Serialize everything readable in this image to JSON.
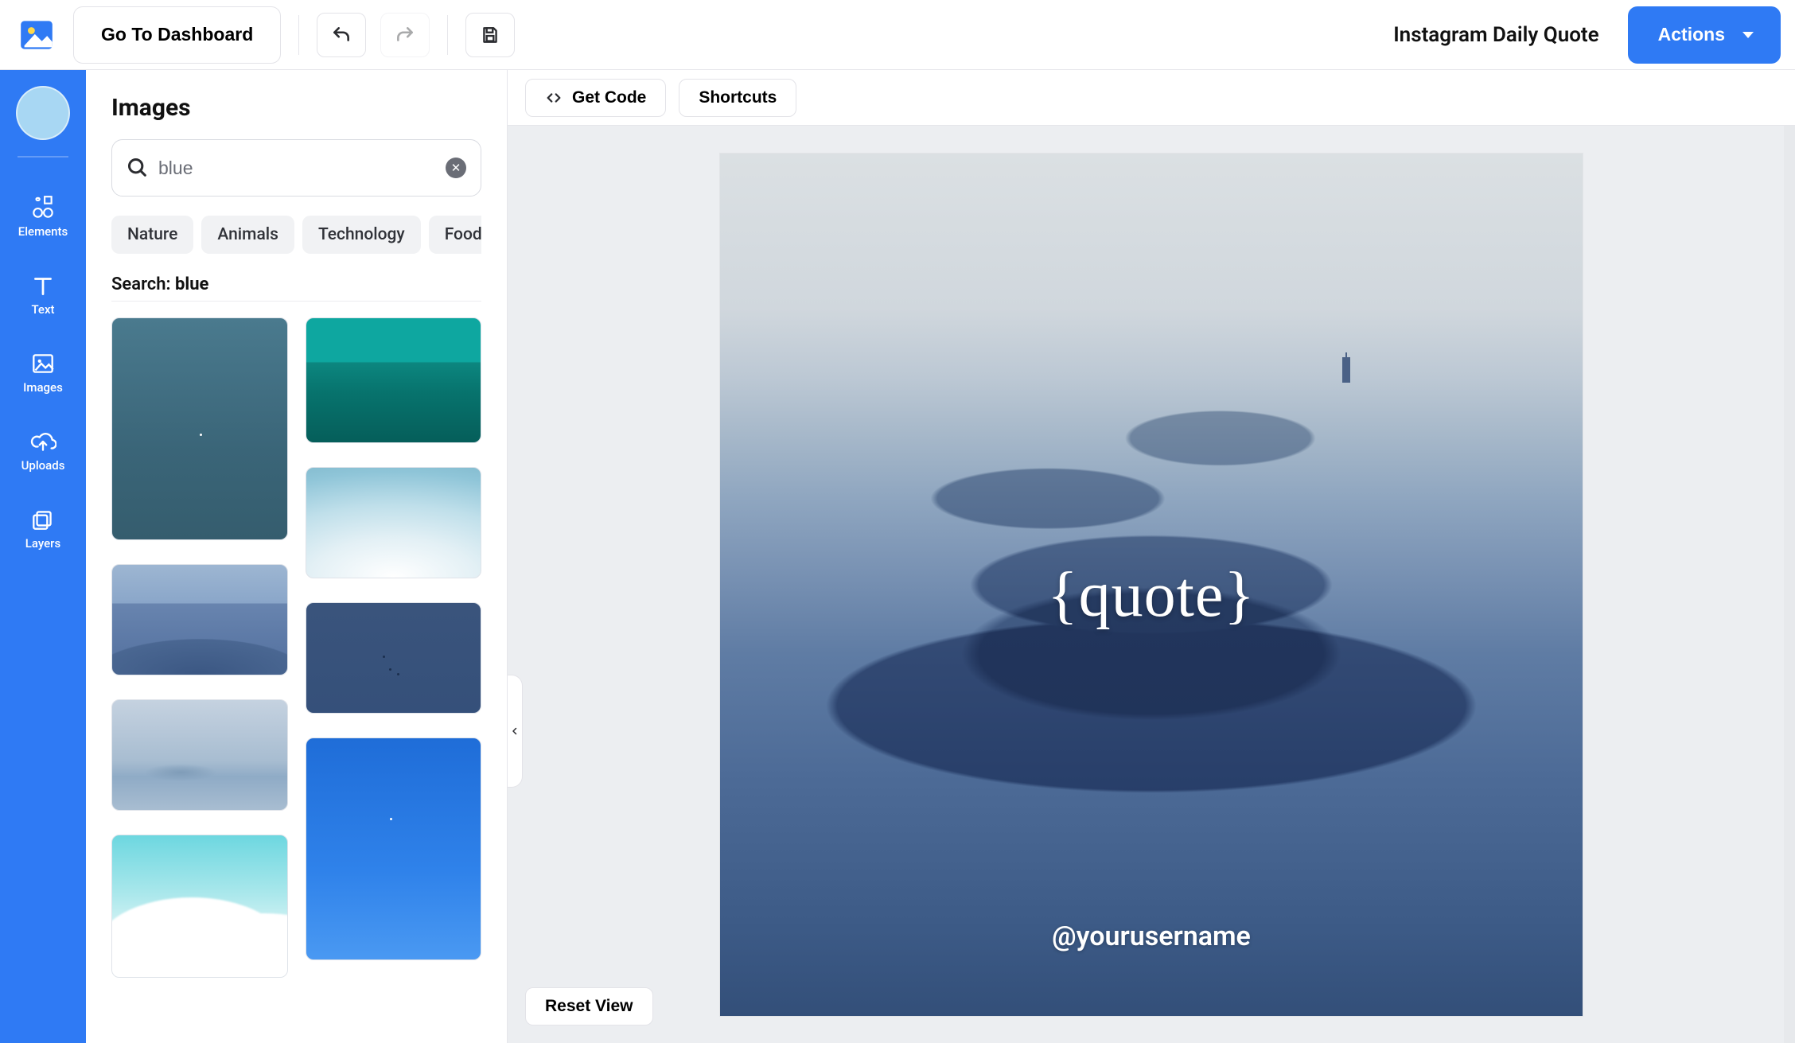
{
  "topbar": {
    "go_dashboard": "Go To Dashboard",
    "doc_title": "Instagram Daily Quote",
    "actions": "Actions"
  },
  "leftrail": {
    "items": [
      {
        "id": "elements",
        "label": "Elements"
      },
      {
        "id": "text",
        "label": "Text"
      },
      {
        "id": "images",
        "label": "Images"
      },
      {
        "id": "uploads",
        "label": "Uploads"
      },
      {
        "id": "layers",
        "label": "Layers"
      }
    ]
  },
  "sidepanel": {
    "title": "Images",
    "search_value": "blue",
    "search_label_prefix": "Search: ",
    "chips": [
      "Nature",
      "Animals",
      "Technology",
      "Food"
    ]
  },
  "canvasbar": {
    "get_code": "Get Code",
    "shortcuts": "Shortcuts"
  },
  "canvas": {
    "quote_text": "{quote}",
    "username": "@yourusername",
    "reset_view": "Reset View"
  }
}
